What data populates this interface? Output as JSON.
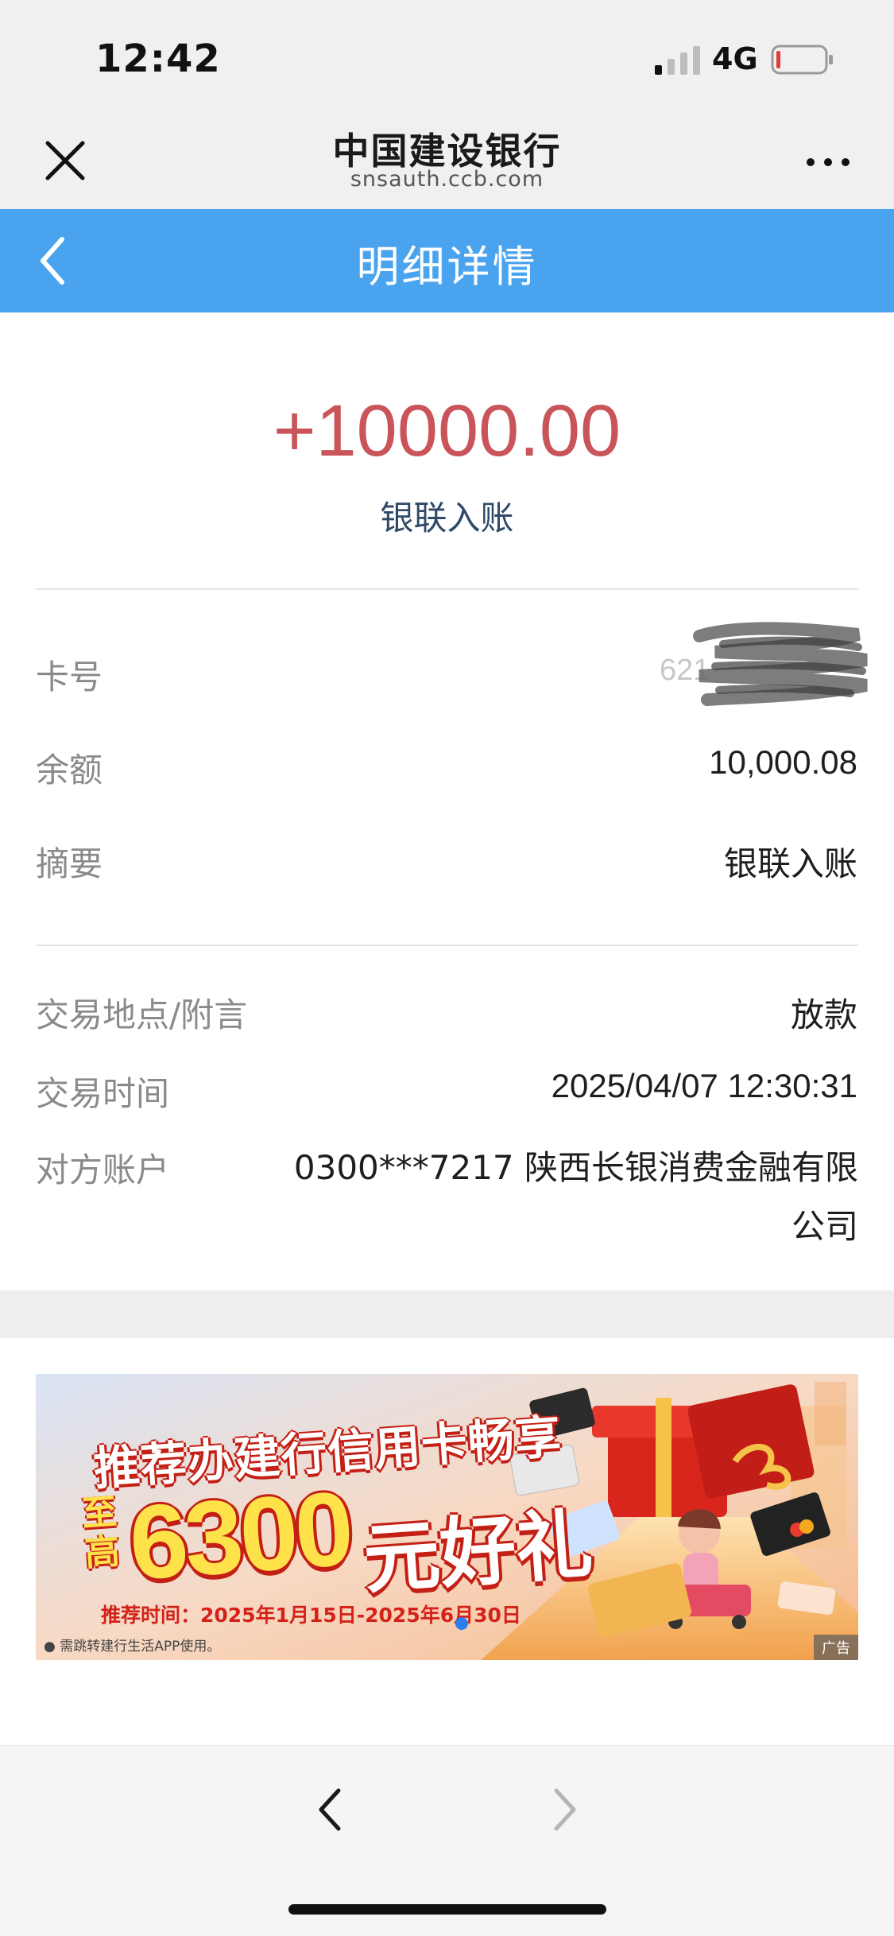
{
  "status": {
    "time": "12:42",
    "network": "4G",
    "icons": [
      "signal-icon",
      "battery-icon"
    ]
  },
  "browser": {
    "title": "中国建设银行",
    "url": "snsauth.ccb.com",
    "icons": [
      "close-icon",
      "more-icon"
    ]
  },
  "nav": {
    "title": "明细详情",
    "icons": [
      "back-chevron-icon"
    ],
    "color": "#4aa3ef"
  },
  "transaction": {
    "amount": "+10000.00",
    "type": "银联入账",
    "amount_color": "#c9545a"
  },
  "details": {
    "card_label": "卡号",
    "card_value": "621",
    "balance_label": "余额",
    "balance_value": "10,000.08",
    "summary_label": "摘要",
    "summary_value": "银联入账",
    "location_label": "交易地点/附言",
    "location_value": "放款",
    "time_label": "交易时间",
    "time_value": "2025/04/07 12:30:31",
    "counterparty_label": "对方账户",
    "counterparty_value": "0300***7217  陕西长银消费金融有限公司"
  },
  "ad": {
    "headline": "推荐办建行信用卡畅享",
    "prefix": "至高",
    "amount": "6300",
    "tail": "元好礼",
    "period": "推荐时间：2025年1月15日-2025年6月30日",
    "note": "● 需跳转建行生活APP使用。",
    "badge": "广告"
  },
  "toolbar": {
    "icons": [
      "back-arrow-icon",
      "forward-arrow-icon"
    ]
  }
}
